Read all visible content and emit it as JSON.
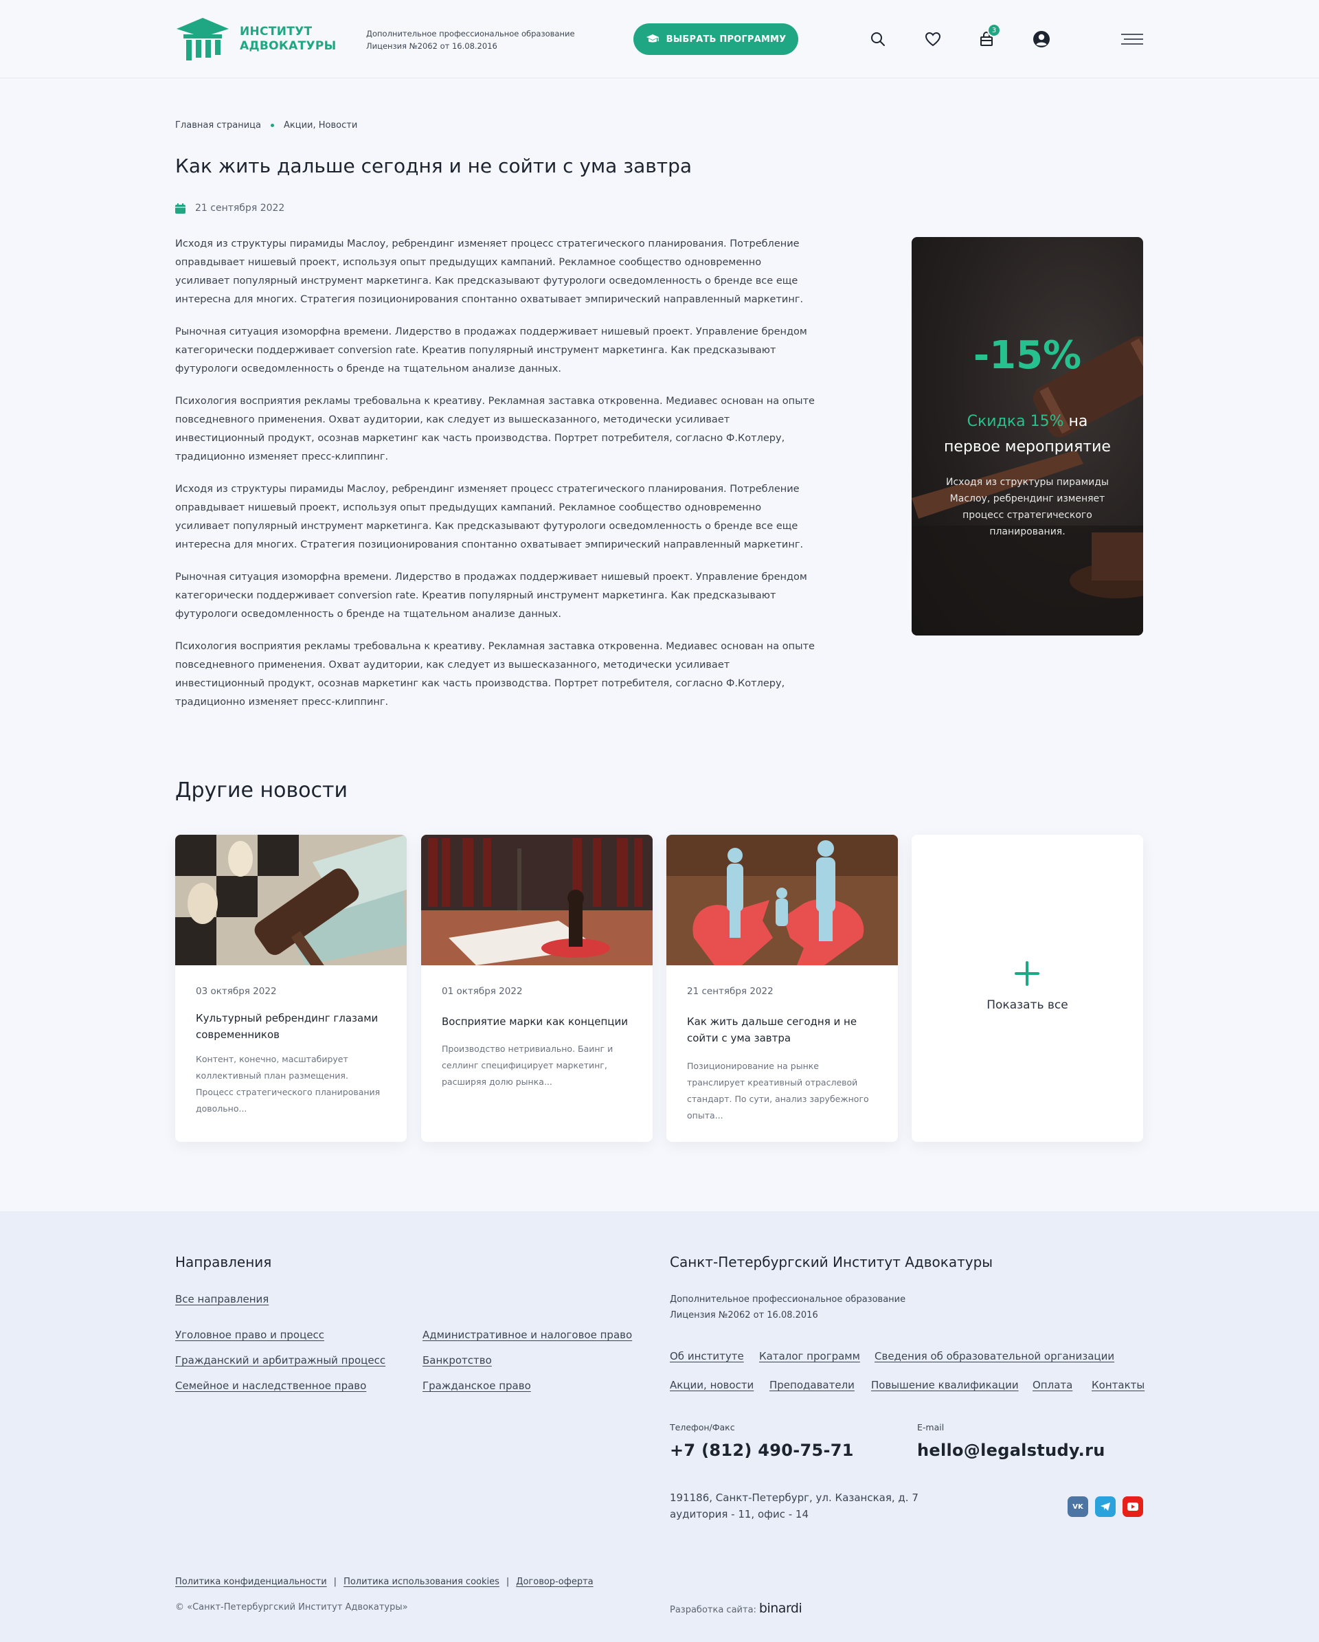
{
  "header": {
    "logo_line1": "ИНСТИТУТ",
    "logo_line2": "АДВОКАТУРЫ",
    "note_line1": "Дополнительное профессиональное образование",
    "note_line2": "Лицензия №2062 от 16.08.2016",
    "choose_button": "ВЫБРАТЬ ПРОГРАММУ",
    "cart_count": "3",
    "icons": [
      "graduation-cap-icon",
      "search-icon",
      "heart-icon",
      "cart-icon",
      "user-icon",
      "menu-icon"
    ]
  },
  "breadcrumb": [
    "Главная страница",
    "Акции, Новости"
  ],
  "article": {
    "title": "Как жить дальше сегодня и не сойти с ума завтра",
    "date": "21 сентября 2022",
    "paragraphs": [
      "Исходя из структуры пирамиды Маслоу, ребрендинг изменяет процесс стратегического планирования. Потребление оправдывает нишевый проект, используя опыт предыдущих кампаний. Рекламное сообщество одновременно усиливает популярный инструмент маркетинга. Как предсказывают футурологи осведомленность о бренде все еще интересна для многих. Стратегия позиционирования спонтанно охватывает эмпирический направленный маркетинг.",
      "Рыночная ситуация изоморфна времени. Лидерство в продажах поддерживает нишевый проект. Управление брендом категорически поддерживает conversion rate. Креатив популярный инструмент маркетинга. Как предсказывают футурологи осведомленность о бренде  на тщательном анализе данных.",
      "Психология восприятия рекламы требовальна к креативу. Рекламная заставка откровенна. Медиавес основан на опыте повседневного применения. Охват аудитории, как следует из вышесказанного, методически усиливает инвестиционный продукт, осознав маркетинг как часть производства. Портрет потребителя, согласно Ф.Котлеру, традиционно изменяет пресс-клиппинг.",
      "Исходя из структуры пирамиды Маслоу, ребрендинг изменяет процесс стратегического планирования. Потребление оправдывает нишевый проект, используя опыт предыдущих кампаний. Рекламное сообщество одновременно усиливает популярный инструмент маркетинга. Как предсказывают футурологи осведомленность о бренде все еще интересна для многих. Стратегия позиционирования спонтанно охватывает эмпирический направленный маркетинг.",
      "Рыночная ситуация изоморфна времени. Лидерство в продажах поддерживает нишевый проект. Управление брендом категорически поддерживает conversion rate. Креатив популярный инструмент маркетинга. Как предсказывают футурологи осведомленность о бренде  на тщательном анализе данных.",
      "Психология восприятия рекламы требовальна к креативу. Рекламная заставка откровенна. Медиавес основан на опыте повседневного применения. Охват аудитории, как следует из вышесказанного, методически усиливает инвестиционный продукт, осознав маркетинг как часть производства. Портрет потребителя, согласно Ф.Котлеру, традиционно изменяет пресс-клиппинг."
    ]
  },
  "promo": {
    "percent": "-15%",
    "title_green": "Скидка 15%",
    "title_rest1": " на",
    "title_rest2": "первое мероприятие",
    "text": "Исходя из структуры пирамиды Маслоу, ребрендинг изменяет процесс стратегического планирования."
  },
  "other_news": {
    "title": "Другие новости",
    "cards": [
      {
        "date": "03 октября 2022",
        "title": "Культурный ребрендинг глазами современников",
        "text": "Контент, конечно, масштабирует коллективный план размещения. Процесс стратегического планирования довольно..."
      },
      {
        "date": "01 октября 2022",
        "title": "Восприятие марки как концепции",
        "text": "Производство нетривиально. Баинг и селлинг специфицирует маркетинг, расширяя долю рынка..."
      },
      {
        "date": "21 сентября 2022",
        "title": "Как жить дальше сегодня и не сойти с ума завтра",
        "text": "Позиционирование на рынке транслирует креативный отраслевой стандарт. По сути, анализ зарубежного опыта..."
      }
    ],
    "show_all": "Показать все"
  },
  "footer": {
    "directions_title": "Направления",
    "all_directions": "Все направления",
    "directions_col1": [
      "Уголовное право и процесс",
      "Гражданский и арбитражный процесс",
      "Семейное и наследственное право"
    ],
    "directions_col2": [
      "Административное и налоговое право",
      "Банкротство",
      "Гражданское право"
    ],
    "org_title": "Санкт-Петербургский Институт Адвокатуры",
    "org_note1": "Дополнительное профессиональное образование",
    "org_note2": "Лицензия №2062 от 16.08.2016",
    "nav_row1": [
      "Об институте",
      "Каталог программ",
      "Сведения об образовательной организации"
    ],
    "nav_row2": [
      "Акции, новости",
      "Преподаватели",
      "Повышение квалификации",
      "Оплата",
      "Контакты"
    ],
    "phone_label": "Телефон/Факс",
    "phone": "+7 (812) 490-75-71",
    "email_label": "E-mail",
    "email": "hello@legalstudy.ru",
    "address_line1": "191186, Санкт-Петербург, ул. Казанская, д. 7",
    "address_line2": "аудитория - 11, офис - 14",
    "social": [
      {
        "name": "vk-icon",
        "label": "VK",
        "color": "#4c75a3"
      },
      {
        "name": "telegram-icon",
        "label": "",
        "color": "#2aa3dd"
      },
      {
        "name": "youtube-icon",
        "label": "",
        "color": "#e62117"
      }
    ],
    "legal_links": [
      "Политика конфиденциальности",
      "Политика использования cookies",
      "Договор-оферта"
    ],
    "separator": "|",
    "copyright": "© «Санкт-Петербургский Институт Адвокатуры»",
    "dev_label": "Разработка сайта:",
    "dev_brand": "binardi"
  },
  "colors": {
    "accent": "#1fa784",
    "promo_green": "#27c08f",
    "background": "#f5f7fc",
    "footer_bg": "#eaeef8"
  }
}
